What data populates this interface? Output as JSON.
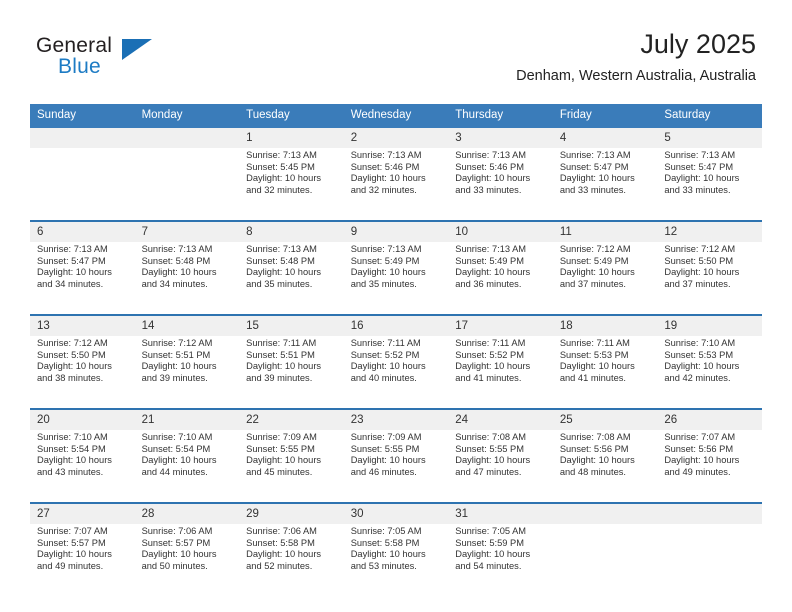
{
  "logo": {
    "word_one": "General",
    "word_two": "Blue",
    "triangle_icon": "triangle-icon"
  },
  "header": {
    "title": "July 2025",
    "location": "Denham, Western Australia, Australia"
  },
  "colors": {
    "header_blue": "#3a7cba",
    "week_divider_blue": "#2e73b0",
    "date_band_gray": "#f0f0f0",
    "logo_blue": "#1d7bc4",
    "text": "#333333"
  },
  "weekday_headers": [
    "Sunday",
    "Monday",
    "Tuesday",
    "Wednesday",
    "Thursday",
    "Friday",
    "Saturday"
  ],
  "weeks": [
    [
      {
        "day": "",
        "lines": []
      },
      {
        "day": "",
        "lines": []
      },
      {
        "day": "1",
        "lines": [
          "Sunrise: 7:13 AM",
          "Sunset: 5:45 PM",
          "Daylight: 10 hours",
          "and 32 minutes."
        ]
      },
      {
        "day": "2",
        "lines": [
          "Sunrise: 7:13 AM",
          "Sunset: 5:46 PM",
          "Daylight: 10 hours",
          "and 32 minutes."
        ]
      },
      {
        "day": "3",
        "lines": [
          "Sunrise: 7:13 AM",
          "Sunset: 5:46 PM",
          "Daylight: 10 hours",
          "and 33 minutes."
        ]
      },
      {
        "day": "4",
        "lines": [
          "Sunrise: 7:13 AM",
          "Sunset: 5:47 PM",
          "Daylight: 10 hours",
          "and 33 minutes."
        ]
      },
      {
        "day": "5",
        "lines": [
          "Sunrise: 7:13 AM",
          "Sunset: 5:47 PM",
          "Daylight: 10 hours",
          "and 33 minutes."
        ]
      }
    ],
    [
      {
        "day": "6",
        "lines": [
          "Sunrise: 7:13 AM",
          "Sunset: 5:47 PM",
          "Daylight: 10 hours",
          "and 34 minutes."
        ]
      },
      {
        "day": "7",
        "lines": [
          "Sunrise: 7:13 AM",
          "Sunset: 5:48 PM",
          "Daylight: 10 hours",
          "and 34 minutes."
        ]
      },
      {
        "day": "8",
        "lines": [
          "Sunrise: 7:13 AM",
          "Sunset: 5:48 PM",
          "Daylight: 10 hours",
          "and 35 minutes."
        ]
      },
      {
        "day": "9",
        "lines": [
          "Sunrise: 7:13 AM",
          "Sunset: 5:49 PM",
          "Daylight: 10 hours",
          "and 35 minutes."
        ]
      },
      {
        "day": "10",
        "lines": [
          "Sunrise: 7:13 AM",
          "Sunset: 5:49 PM",
          "Daylight: 10 hours",
          "and 36 minutes."
        ]
      },
      {
        "day": "11",
        "lines": [
          "Sunrise: 7:12 AM",
          "Sunset: 5:49 PM",
          "Daylight: 10 hours",
          "and 37 minutes."
        ]
      },
      {
        "day": "12",
        "lines": [
          "Sunrise: 7:12 AM",
          "Sunset: 5:50 PM",
          "Daylight: 10 hours",
          "and 37 minutes."
        ]
      }
    ],
    [
      {
        "day": "13",
        "lines": [
          "Sunrise: 7:12 AM",
          "Sunset: 5:50 PM",
          "Daylight: 10 hours",
          "and 38 minutes."
        ]
      },
      {
        "day": "14",
        "lines": [
          "Sunrise: 7:12 AM",
          "Sunset: 5:51 PM",
          "Daylight: 10 hours",
          "and 39 minutes."
        ]
      },
      {
        "day": "15",
        "lines": [
          "Sunrise: 7:11 AM",
          "Sunset: 5:51 PM",
          "Daylight: 10 hours",
          "and 39 minutes."
        ]
      },
      {
        "day": "16",
        "lines": [
          "Sunrise: 7:11 AM",
          "Sunset: 5:52 PM",
          "Daylight: 10 hours",
          "and 40 minutes."
        ]
      },
      {
        "day": "17",
        "lines": [
          "Sunrise: 7:11 AM",
          "Sunset: 5:52 PM",
          "Daylight: 10 hours",
          "and 41 minutes."
        ]
      },
      {
        "day": "18",
        "lines": [
          "Sunrise: 7:11 AM",
          "Sunset: 5:53 PM",
          "Daylight: 10 hours",
          "and 41 minutes."
        ]
      },
      {
        "day": "19",
        "lines": [
          "Sunrise: 7:10 AM",
          "Sunset: 5:53 PM",
          "Daylight: 10 hours",
          "and 42 minutes."
        ]
      }
    ],
    [
      {
        "day": "20",
        "lines": [
          "Sunrise: 7:10 AM",
          "Sunset: 5:54 PM",
          "Daylight: 10 hours",
          "and 43 minutes."
        ]
      },
      {
        "day": "21",
        "lines": [
          "Sunrise: 7:10 AM",
          "Sunset: 5:54 PM",
          "Daylight: 10 hours",
          "and 44 minutes."
        ]
      },
      {
        "day": "22",
        "lines": [
          "Sunrise: 7:09 AM",
          "Sunset: 5:55 PM",
          "Daylight: 10 hours",
          "and 45 minutes."
        ]
      },
      {
        "day": "23",
        "lines": [
          "Sunrise: 7:09 AM",
          "Sunset: 5:55 PM",
          "Daylight: 10 hours",
          "and 46 minutes."
        ]
      },
      {
        "day": "24",
        "lines": [
          "Sunrise: 7:08 AM",
          "Sunset: 5:55 PM",
          "Daylight: 10 hours",
          "and 47 minutes."
        ]
      },
      {
        "day": "25",
        "lines": [
          "Sunrise: 7:08 AM",
          "Sunset: 5:56 PM",
          "Daylight: 10 hours",
          "and 48 minutes."
        ]
      },
      {
        "day": "26",
        "lines": [
          "Sunrise: 7:07 AM",
          "Sunset: 5:56 PM",
          "Daylight: 10 hours",
          "and 49 minutes."
        ]
      }
    ],
    [
      {
        "day": "27",
        "lines": [
          "Sunrise: 7:07 AM",
          "Sunset: 5:57 PM",
          "Daylight: 10 hours",
          "and 49 minutes."
        ]
      },
      {
        "day": "28",
        "lines": [
          "Sunrise: 7:06 AM",
          "Sunset: 5:57 PM",
          "Daylight: 10 hours",
          "and 50 minutes."
        ]
      },
      {
        "day": "29",
        "lines": [
          "Sunrise: 7:06 AM",
          "Sunset: 5:58 PM",
          "Daylight: 10 hours",
          "and 52 minutes."
        ]
      },
      {
        "day": "30",
        "lines": [
          "Sunrise: 7:05 AM",
          "Sunset: 5:58 PM",
          "Daylight: 10 hours",
          "and 53 minutes."
        ]
      },
      {
        "day": "31",
        "lines": [
          "Sunrise: 7:05 AM",
          "Sunset: 5:59 PM",
          "Daylight: 10 hours",
          "and 54 minutes."
        ]
      },
      {
        "day": "",
        "lines": []
      },
      {
        "day": "",
        "lines": []
      }
    ]
  ]
}
